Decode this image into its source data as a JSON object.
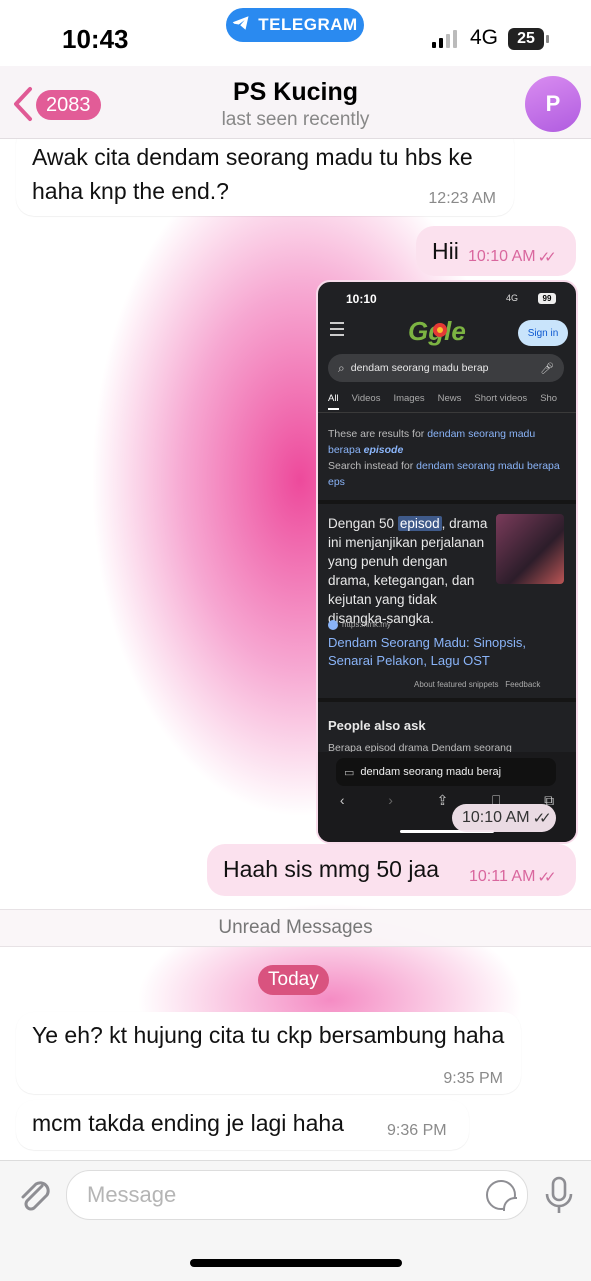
{
  "status_bar": {
    "time": "10:43",
    "return_app": "TELEGRAM",
    "network": "4G",
    "battery": "25"
  },
  "header": {
    "back_count": "2083",
    "chat_title": "PS Kucing",
    "status": "last seen recently",
    "avatar_letter": "P"
  },
  "messages": [
    {
      "direction": "in",
      "text": "Awak cita dendam seorang madu tu hbs ke haha knp the end.?",
      "time": "12:23 AM"
    },
    {
      "direction": "out",
      "text": "Hii",
      "time": "10:10 AM"
    },
    {
      "direction": "out",
      "type": "photo",
      "time": "10:10 AM"
    },
    {
      "direction": "out",
      "text": "Haah sis mmg 50 jaa",
      "time": "10:11 AM"
    },
    {
      "direction": "in",
      "text": "Ye eh? kt hujung cita tu ckp bersambung haha",
      "time": "9:35 PM"
    },
    {
      "direction": "in",
      "text": "mcm takda ending je lagi haha",
      "time": "9:36 PM"
    }
  ],
  "screenshot": {
    "time": "10:10",
    "network": "4G",
    "battery": "99",
    "sign_in": "Sign in",
    "query": "dendam seorang madu berap",
    "tabs": [
      "All",
      "Videos",
      "Images",
      "News",
      "Short videos",
      "Sho"
    ],
    "results_prefix": "These are results for ",
    "results_query": "dendam seorang madu berapa ",
    "results_query_em": "episode",
    "instead_prefix": "Search instead for ",
    "instead_query": "dendam seorang madu berapa eps",
    "snippet_before": "Dengan 50 ",
    "snippet_highlight": "episod",
    "snippet_after": ", drama ini menjanjikan perjalanan yang penuh dengan drama, ketegangan, dan kejutan yang tidak disangka-sangka.",
    "source_url": "https://link.my",
    "result_title": "Dendam Seorang Madu: Sinopsis, Senarai Pelakon, Lagu OST",
    "about_snippets": "About featured snippets",
    "feedback": "Feedback",
    "people_also_ask": "People also ask",
    "paa_partial": "Berapa episod drama Dendam seorang",
    "address_bar": "dendam seorang madu beraj"
  },
  "unread_label": "Unread Messages",
  "date_label": "Today",
  "input": {
    "placeholder": "Message"
  },
  "colors": {
    "accent_pink": "#e25c97",
    "outgoing_bubble": "#fbe1ee",
    "telegram_blue": "#2a8af0"
  },
  "icons": [
    "back-chevron-icon",
    "telegram-plane-icon",
    "attach-icon",
    "sticker-icon",
    "mic-icon",
    "read-checks-icon"
  ]
}
